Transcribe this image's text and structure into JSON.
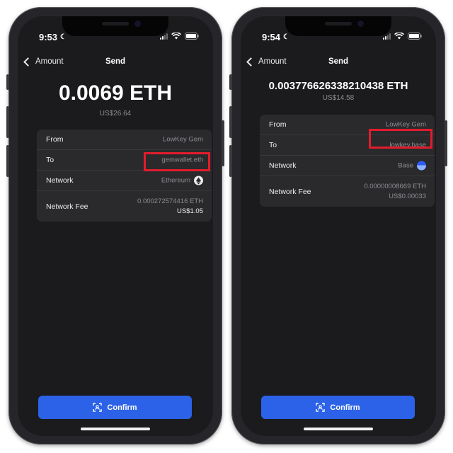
{
  "phones": [
    {
      "time": "9:53",
      "nav": {
        "back_label": "Amount",
        "title": "Send"
      },
      "amount": "0.0069 ETH",
      "amount_usd": "US$26.64",
      "details": {
        "from_label": "From",
        "from_value": "LowKey Gem",
        "to_label": "To",
        "to_value": "gemwallet.eth",
        "network_label": "Network",
        "network_value": "Ethereum",
        "network_icon": "ethereum-icon",
        "fee_label": "Network Fee",
        "fee_value": "0.000272574416 ETH",
        "fee_usd": "US$1.05"
      },
      "confirm_label": "Confirm"
    },
    {
      "time": "9:54",
      "nav": {
        "back_label": "Amount",
        "title": "Send"
      },
      "amount": "0.003776626338210438 ETH",
      "amount_usd": "US$14.58",
      "details": {
        "from_label": "From",
        "from_value": "LowKey Gem",
        "to_label": "To",
        "to_value": "lowkey.base",
        "network_label": "Network",
        "network_value": "Base",
        "network_icon": "base-icon",
        "fee_label": "Network Fee",
        "fee_value": "0.00000008669 ETH",
        "fee_usd": "US$0.00033"
      },
      "confirm_label": "Confirm"
    }
  ],
  "colors": {
    "screen_bg": "#1b1b1d",
    "card_bg": "#2a2a2d",
    "accent": "#2b62e8",
    "highlight": "#e21c2c",
    "muted_text": "#8d8d92"
  }
}
